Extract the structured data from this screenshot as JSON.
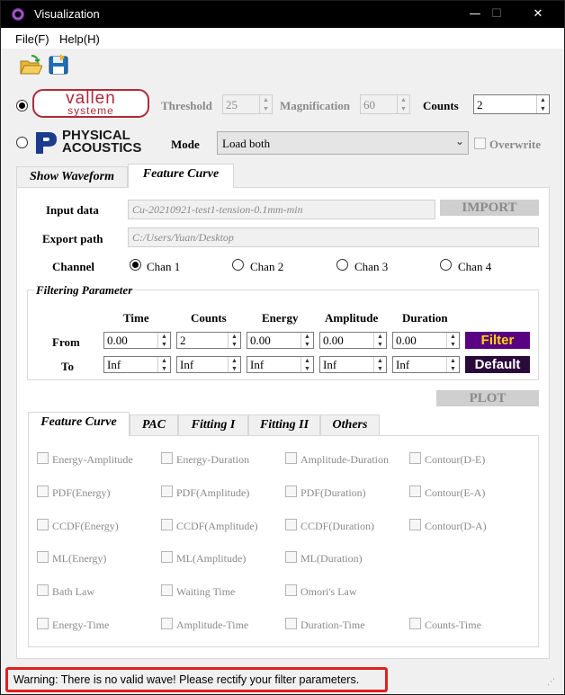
{
  "window": {
    "title": "Visualization",
    "minimize": "—",
    "maximize": "☐",
    "close": "✕"
  },
  "menu": {
    "file": "File(F)",
    "help": "Help(H)"
  },
  "toolbar": {
    "open_icon": "open-folder-icon",
    "save_icon": "save-disk-icon"
  },
  "source": {
    "vallen_logo_top": "vallen",
    "vallen_logo_bottom": "systeme",
    "pac_logo_line1": "PHYSICAL",
    "pac_logo_line2": "ACOUSTICS",
    "selected": "vallen"
  },
  "params": {
    "threshold_label": "Threshold",
    "threshold_value": "25",
    "magnification_label": "Magnification",
    "magnification_value": "60",
    "counts_label": "Counts",
    "counts_value": "2",
    "mode_label": "Mode",
    "mode_value": "Load both",
    "overwrite_label": "Overwrite"
  },
  "top_tabs": [
    "Show Waveform",
    "Feature Curve"
  ],
  "feature": {
    "input_label": "Input data",
    "input_value": "Cu-20210921-test1-tension-0.1mm-min",
    "import_button": "IMPORT",
    "export_label": "Export path",
    "export_value": "C:/Users/Yuan/Desktop",
    "channel_label": "Channel",
    "channels": [
      "Chan 1",
      "Chan 2",
      "Chan 3",
      "Chan 4"
    ],
    "selected_channel": "Chan 1"
  },
  "filter": {
    "group_title": "Filtering Parameter",
    "columns": [
      "Time",
      "Counts",
      "Energy",
      "Amplitude",
      "Duration"
    ],
    "from_label": "From",
    "to_label": "To",
    "from_values": [
      "0.00",
      "2",
      "0.00",
      "0.00",
      "0.00"
    ],
    "to_values": [
      "Inf",
      "Inf",
      "Inf",
      "Inf",
      "Inf"
    ],
    "filter_button": "Filter",
    "default_button": "Default",
    "filter_color": "#5a0082",
    "default_color": "#2a0a3a",
    "button_text_color": "#ffd700"
  },
  "plot_button": "PLOT",
  "sub_tabs": [
    "Feature Curve",
    "PAC",
    "Fitting I",
    "Fitting II",
    "Others"
  ],
  "options": [
    [
      "Energy-Amplitude",
      "Energy-Duration",
      "Amplitude-Duration",
      "Contour(D-E)"
    ],
    [
      "PDF(Energy)",
      "PDF(Amplitude)",
      "PDF(Duration)",
      "Contour(E-A)"
    ],
    [
      "CCDF(Energy)",
      "CCDF(Amplitude)",
      "CCDF(Duration)",
      "Contour(D-A)"
    ],
    [
      "ML(Energy)",
      "ML(Amplitude)",
      "ML(Duration)"
    ],
    [
      "Bath Law",
      "Waiting Time",
      "Omori's Law"
    ],
    [
      "Energy-Time",
      "Amplitude-Time",
      "Duration-Time",
      "Counts-Time"
    ]
  ],
  "status": {
    "message": "Warning: There is no valid wave! Please rectify your filter parameters.",
    "highlight_color": "#e02020"
  }
}
